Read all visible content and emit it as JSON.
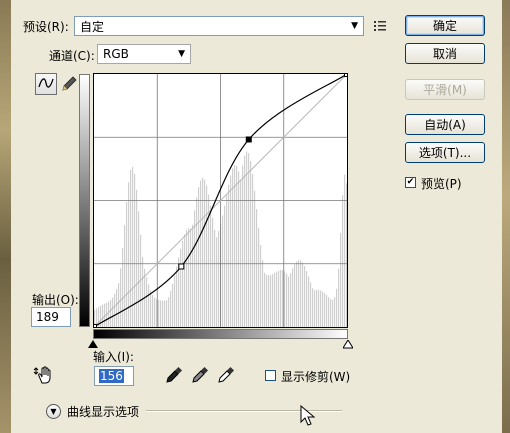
{
  "preset": {
    "label": "预设(R):",
    "value": "自定"
  },
  "channel": {
    "label": "通道(C):",
    "value": "RGB"
  },
  "buttons": {
    "ok": "确定",
    "cancel": "取消",
    "smooth": "平滑(M)",
    "auto": "自动(A)",
    "options": "选项(T)..."
  },
  "preview": {
    "label": "预览(P)",
    "checked": true
  },
  "output": {
    "label": "输出(O):",
    "value": "189"
  },
  "input": {
    "label": "输入(I):",
    "value": "156"
  },
  "show_clipping": {
    "label": "显示修剪(W)",
    "checked": false
  },
  "curve_display": {
    "label": "曲线显示选项"
  },
  "icons": {
    "preset_menu": "preset-menu-icon",
    "curve_tool": "curve-tool-icon",
    "pencil_tool": "pencil-icon",
    "hand_adjust": "hand-adjust-icon",
    "eyedropper_black": "eyedropper-black-icon",
    "eyedropper_gray": "eyedropper-gray-icon",
    "eyedropper_white": "eyedropper-white-icon",
    "expand": "expand-icon",
    "cursor": "cursor-icon"
  },
  "chart_data": {
    "type": "line",
    "curve_points": [
      [
        0,
        0
      ],
      [
        88,
        61
      ],
      [
        156,
        189
      ],
      [
        255,
        255
      ]
    ],
    "selected_point": [
      156,
      189
    ],
    "xlim": [
      0,
      255
    ],
    "ylim": [
      0,
      255
    ],
    "grid": "4x4",
    "histogram_color": "#cfcfcf",
    "curve_color": "#000000"
  }
}
